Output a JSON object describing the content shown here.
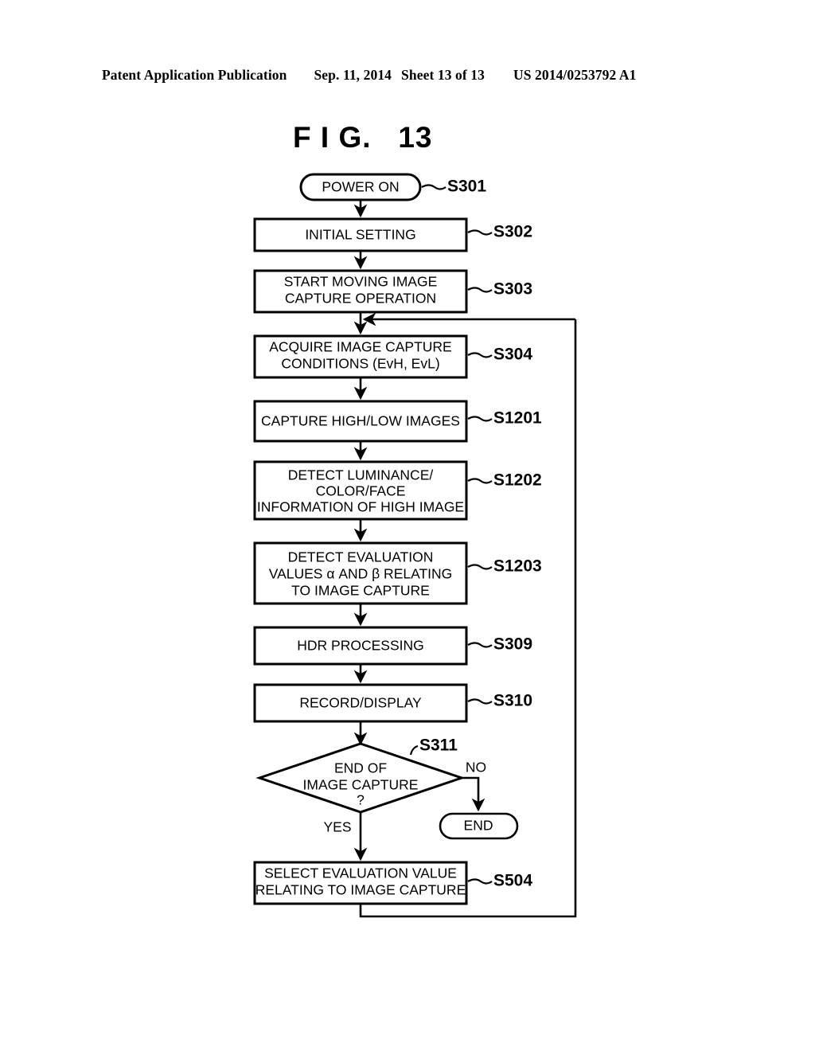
{
  "header": {
    "publication": "Patent Application Publication",
    "date": "Sep. 11, 2014",
    "sheet": "Sheet 13 of 13",
    "patent_number": "US 2014/0253792 A1"
  },
  "figure": {
    "title": "F I G.   13"
  },
  "flowchart": {
    "nodes": [
      {
        "id": "S301",
        "shape": "terminator",
        "label": "POWER ON"
      },
      {
        "id": "S302",
        "shape": "process",
        "label": "INITIAL SETTING"
      },
      {
        "id": "S303",
        "shape": "process",
        "label_line1": "START MOVING IMAGE",
        "label_line2": "CAPTURE OPERATION"
      },
      {
        "id": "S304",
        "shape": "process",
        "label_line1": "ACQUIRE IMAGE CAPTURE",
        "label_line2": "CONDITIONS (EvH, EvL)"
      },
      {
        "id": "S1201",
        "shape": "process",
        "label": "CAPTURE HIGH/LOW IMAGES"
      },
      {
        "id": "S1202",
        "shape": "process",
        "label_line1": "DETECT LUMINANCE/",
        "label_line2": "COLOR/FACE",
        "label_line3": "INFORMATION OF HIGH IMAGE"
      },
      {
        "id": "S1203",
        "shape": "process",
        "label_line1": "DETECT EVALUATION",
        "label_line2": "VALUES α AND β RELATING",
        "label_line3": "TO IMAGE CAPTURE"
      },
      {
        "id": "S309",
        "shape": "process",
        "label": "HDR PROCESSING"
      },
      {
        "id": "S310",
        "shape": "process",
        "label": "RECORD/DISPLAY"
      },
      {
        "id": "S311",
        "shape": "decision",
        "label_line1": "END OF",
        "label_line2": "IMAGE CAPTURE",
        "label_line3": "?"
      },
      {
        "id": "S504",
        "shape": "process",
        "label_line1": "SELECT EVALUATION VALUE",
        "label_line2": "RELATING TO IMAGE CAPTURE"
      },
      {
        "id": "END",
        "shape": "terminator",
        "label": "END"
      }
    ],
    "branches": {
      "yes": "YES",
      "no": "NO"
    }
  }
}
